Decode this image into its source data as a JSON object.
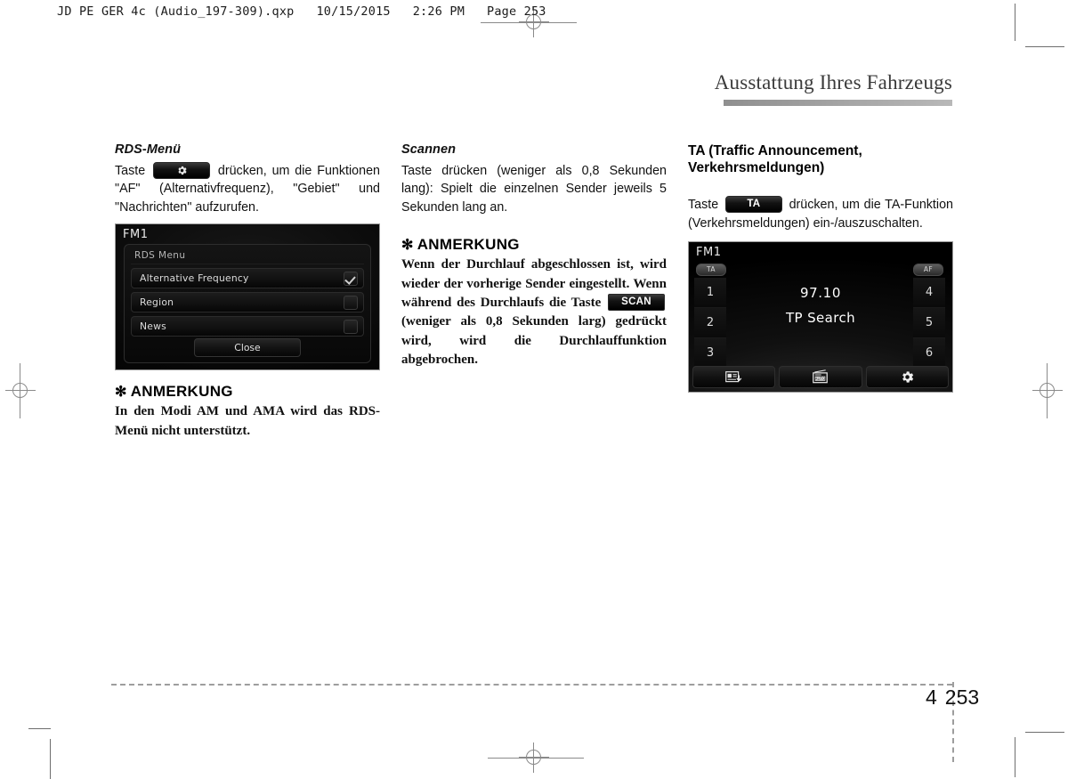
{
  "prepress": {
    "qxp_header": "JD PE GER 4c (Audio_197-309).qxp   10/15/2015   2:26 PM   Page 253"
  },
  "chapter": {
    "title": "Ausstattung Ihres Fahrzeugs"
  },
  "columns": {
    "col1": {
      "sub_head": "RDS-Menü",
      "para_before": "Taste",
      "button_label": "",
      "button_icon": "gear-icon",
      "para_after": "drücken, um die Funktionen \"AF\" (Alternativfrequenz), \"Gebiet\" und \"Nachrichten\" aufzurufen.",
      "note": {
        "star": "✻",
        "head": "ANMERKUNG",
        "body": "In den Modi AM und AMA wird das RDS-Menü nicht unterstützt."
      }
    },
    "col2": {
      "sub_head": "Scannen",
      "para": "Taste drücken (weniger als 0,8 Sekunden lang): Spielt die einzelnen Sender jeweils 5 Sekunden lang an.",
      "note": {
        "star": "✻",
        "head": "ANMERKUNG",
        "body_before": "Wenn der Durchlauf abgeschlossen ist, wird wieder der vorherige Sender eingestellt. Wenn während des Durchlaufs die Taste",
        "scan_button": "SCAN",
        "body_after": "(weniger als 0,8 Sekunden larg) gedrückt wird, wird die Durchlauffunktion abgebrochen."
      }
    },
    "col3": {
      "sec_head_line1": "TA (Traffic Announcement,",
      "sec_head_line2": "Verkehrsmeldungen)",
      "para_before": "Taste",
      "ta_button": "TA",
      "para_after": "drücken, um die TA-Funktion (Verkehrsmeldungen) ein-/auszuschalten."
    }
  },
  "screens": {
    "rds_menu": {
      "source_label": "FM1",
      "panel_title": "RDS Menu",
      "rows": [
        {
          "label": "Alternative Frequency",
          "checked": true
        },
        {
          "label": "Region",
          "checked": false
        },
        {
          "label": "News",
          "checked": false
        }
      ],
      "close_label": "Close"
    },
    "fm_radio": {
      "source_label": "FM1",
      "badge_ta": "TA",
      "badge_af": "AF",
      "presets_left": [
        "1",
        "2",
        "3"
      ],
      "presets_right": [
        "4",
        "5",
        "6"
      ],
      "frequency": "97.10",
      "status": "TP Search",
      "bottom_buttons": [
        {
          "icon": "radio-save-icon"
        },
        {
          "icon": "radio-auto-icon"
        },
        {
          "icon": "gear-icon"
        }
      ]
    }
  },
  "footer": {
    "chapter_number": "4",
    "page_number": "253"
  }
}
